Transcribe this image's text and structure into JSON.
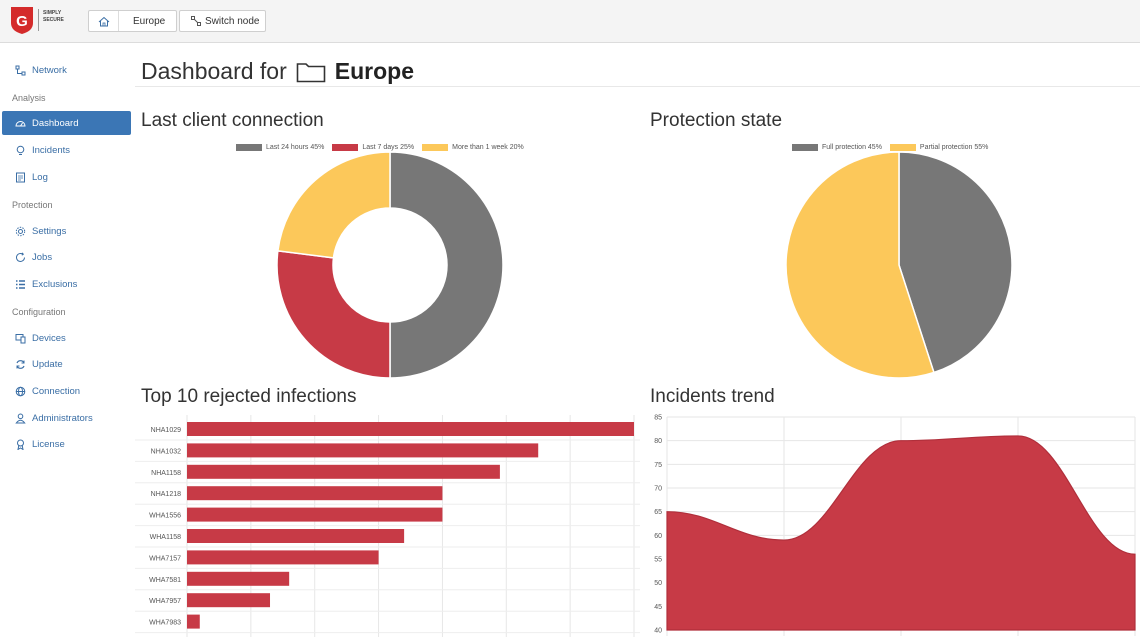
{
  "header": {
    "logo_text_line1": "G DATA",
    "logo_text_line2": "SIMPLY",
    "logo_text_line3": "SECURE",
    "breadcrumb_label": "Europe",
    "switch_node_label": "Switch node"
  },
  "sidebar": {
    "network": "Network",
    "analysis_header": "Analysis",
    "dashboard": "Dashboard",
    "incidents": "Incidents",
    "log": "Log",
    "protection_header": "Protection",
    "settings": "Settings",
    "jobs": "Jobs",
    "exclusions": "Exclusions",
    "configuration_header": "Configuration",
    "devices": "Devices",
    "update": "Update",
    "connection": "Connection",
    "administrators": "Administrators",
    "license": "License"
  },
  "page": {
    "title_prefix": "Dashboard for",
    "title_node": "Europe"
  },
  "colors": {
    "gray": "#777777",
    "red": "#c73a46",
    "yellow": "#fcc85a",
    "accent": "#3b76b5"
  },
  "chart_data": [
    {
      "type": "pie",
      "title": "Last client connection",
      "labels": [
        "Last 24 hours 45%",
        "Last 7 days 25%",
        "More than 1 week 20%"
      ],
      "values": [
        50,
        27,
        23
      ],
      "donut": true
    },
    {
      "type": "pie",
      "title": "Protection state",
      "labels": [
        "Full protection 45%",
        "Partial protection 55%"
      ],
      "values": [
        45,
        55
      ],
      "donut": false
    },
    {
      "type": "bar",
      "title": "Top 10 rejected infections",
      "orientation": "horizontal",
      "categories": [
        "NHA1029",
        "NHA1032",
        "NHA1158",
        "NHA1218",
        "WHA1556",
        "WHA1158",
        "WHA7157",
        "WHA7581",
        "WHA7957",
        "WHA7983"
      ],
      "values": [
        35,
        27.5,
        24.5,
        20,
        20,
        17,
        15,
        8,
        6.5,
        1
      ]
    },
    {
      "type": "area",
      "title": "Incidents trend",
      "yticks": [
        40,
        45,
        50,
        55,
        60,
        65,
        70,
        75,
        80,
        85
      ],
      "ylim": [
        40,
        85
      ],
      "x": [
        0,
        1,
        2,
        3,
        4
      ],
      "values": [
        65,
        59,
        80,
        81,
        56
      ]
    }
  ]
}
